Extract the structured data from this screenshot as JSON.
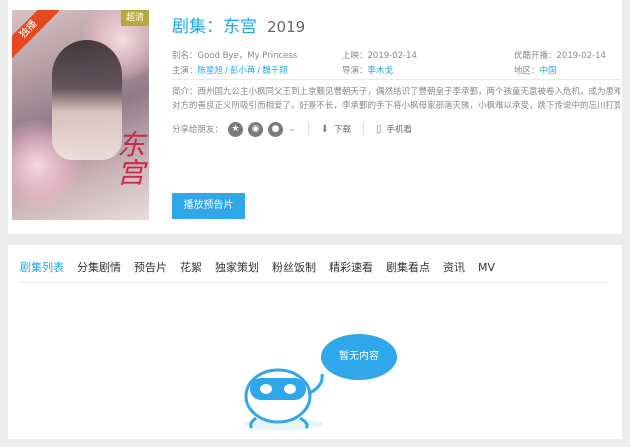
{
  "title": {
    "text": "剧集：东宫",
    "year": "2019"
  },
  "poster": {
    "badge_exclusive": "独播",
    "badge_hd": "超清",
    "calligraphy": "东宫"
  },
  "meta": {
    "alias_label": "别名：",
    "alias_value": "Good Bye，My Princess",
    "release_label": "上映：",
    "release_value": "2019-02-14",
    "vip_label": "优酷开播：",
    "vip_value": "2019-02-14",
    "cast_label": "主演：",
    "cast": [
      "陈星旭",
      "彭小苒",
      "魏千翔"
    ],
    "director_label": "导演：",
    "director_value": "李木戈",
    "region_label": "地区：",
    "region_value": "中国"
  },
  "synopsis": {
    "line1": "简介：西州国九公主小枫同父王到上京觐见豐朝天子，偶然结识了豐朝皇子李承鄞，两个孩童无意被卷入危机，成为患难之交。",
    "line2": "对方的善良正义所吸引而相爱了。好景不长，李承鄞的手下将小枫母家部落灭族，小枫难以承受，跳下传说中的忘川打算忘情，"
  },
  "share": {
    "label": "分享给朋友：",
    "download": "下载",
    "mobile": "手机看"
  },
  "play_button": "播放预告片",
  "tabs": [
    "剧集列表",
    "分集剧情",
    "预告片",
    "花絮",
    "独家策划",
    "粉丝饭制",
    "精彩速看",
    "剧集看点",
    "资讯",
    "MV"
  ],
  "empty_state": "暂无内容",
  "colors": {
    "accent": "#21a7e8",
    "button": "#2fa7ea",
    "background": "#ececec"
  }
}
